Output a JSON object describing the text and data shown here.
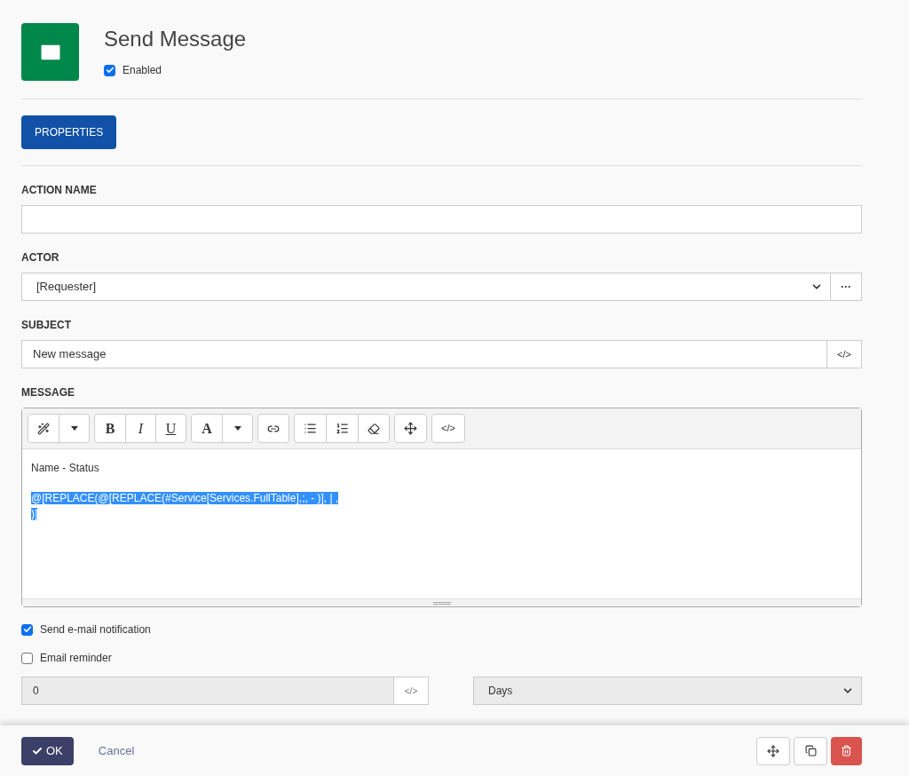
{
  "header": {
    "title": "Send Message",
    "enabled": {
      "label": "Enabled",
      "checked": true
    }
  },
  "tabs": [
    {
      "label": "PROPERTIES",
      "selected": true
    }
  ],
  "action_name": {
    "label": "ACTION NAME"
  },
  "actor": {
    "label": "ACTOR",
    "value": "[Requester]",
    "more": "···"
  },
  "subject": {
    "label": "SUBJECT",
    "value": "New message",
    "code": "</>"
  },
  "message": {
    "label": "MESSAGE",
    "toolbar": [
      [
        {
          "kind": "magic"
        },
        {
          "kind": "dropdown"
        }
      ],
      [
        {
          "kind": "bold",
          "text": "B"
        },
        {
          "kind": "italic",
          "text": "I"
        },
        {
          "kind": "underline",
          "text": "U"
        }
      ],
      [
        {
          "kind": "color",
          "text": "A"
        },
        {
          "kind": "dropdown"
        }
      ],
      [
        {
          "kind": "link"
        }
      ],
      [
        {
          "kind": "bullets"
        },
        {
          "kind": "numbers"
        },
        {
          "kind": "eraser"
        }
      ],
      [
        {
          "kind": "move"
        }
      ],
      [
        {
          "kind": "code",
          "text": "</>"
        }
      ]
    ],
    "lines": [
      {
        "text": "Name - Status",
        "selected": false
      },
      {
        "text": "@[REPLACE(@[REPLACE(#Service[Services.FullTable],;, - )], | ,",
        "selected": true
      },
      {
        "text": ")]",
        "selected": true
      }
    ]
  },
  "options": [
    {
      "label": "Send e-mail notification",
      "checked": true
    },
    {
      "label": "Email reminder",
      "checked": false
    }
  ],
  "reminder": {
    "value": "0",
    "code": "</>",
    "unit": "Days"
  },
  "footer": {
    "ok": "OK",
    "cancel": "Cancel"
  }
}
